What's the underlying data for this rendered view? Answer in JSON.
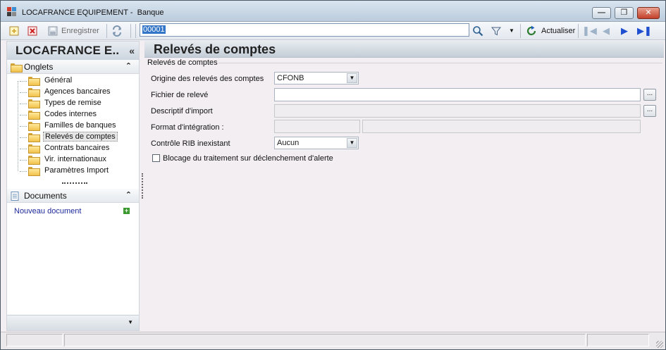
{
  "window": {
    "app_name": "LOCAFRANCE EQUIPEMENT - ",
    "module": "Banque",
    "minimize_icon": "minimize-icon",
    "maximize_icon": "restore-icon",
    "close_icon": "close-icon"
  },
  "toolbar": {
    "save_label": "Enregistrer",
    "code_value": "00001",
    "refresh_label": "Actualiser"
  },
  "sidebar": {
    "title": "LOCAFRANCE E..",
    "collapse_glyph": "«",
    "onglets_label": "Onglets",
    "items": [
      {
        "label": "Général"
      },
      {
        "label": "Agences bancaires"
      },
      {
        "label": "Types de remise"
      },
      {
        "label": "Codes internes"
      },
      {
        "label": "Familles de banques"
      },
      {
        "label": "Relevés de comptes"
      },
      {
        "label": "Contrats bancaires"
      },
      {
        "label": "Vir. internationaux"
      },
      {
        "label": "Paramètres Import"
      }
    ],
    "selected_index": 5,
    "documents_label": "Documents",
    "new_document_label": "Nouveau document"
  },
  "main": {
    "title": "Relevés de comptes",
    "group_label": "Relevés de comptes",
    "fields": {
      "origine_label": "Origine des relevés des comptes",
      "origine_value": "CFONB",
      "fichier_label": "Fichier de relevé",
      "fichier_value": "",
      "descriptif_label": "Descriptif d'import",
      "format_label": "Format d'intégration :",
      "controle_label": "Contrôle RIB inexistant",
      "controle_value": "Aucun",
      "blocage_label": "Blocage du traitement sur déclenchement d'alerte",
      "blocage_checked": false
    }
  },
  "colors": {
    "accent": "#3376c8",
    "link": "#1c2a9c",
    "close_button": "#c2402a",
    "folder": "#f1c24c"
  }
}
